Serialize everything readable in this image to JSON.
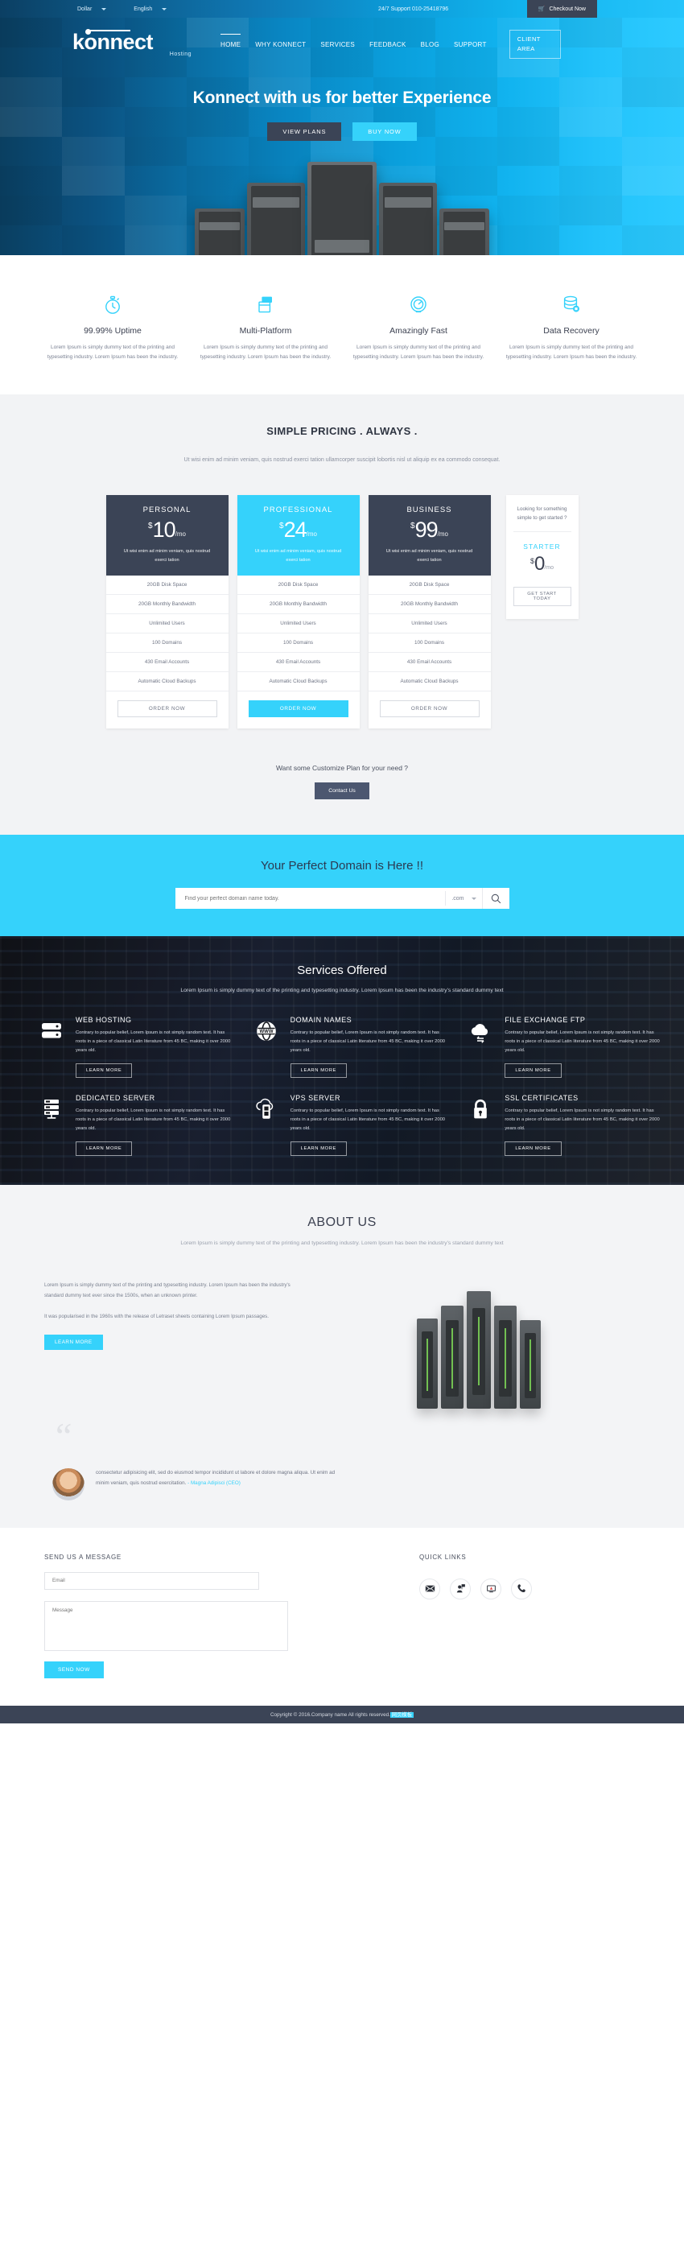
{
  "topbar": {
    "currency": "Dollar",
    "language": "English",
    "support": "24/7 Support 010-25418796",
    "checkout": "Checkout Now",
    "cart_icon": "cart-icon"
  },
  "brand": {
    "name": "konnect",
    "tagline": "Hosting"
  },
  "nav": {
    "items": [
      {
        "label": "HOME",
        "active": true
      },
      {
        "label": "WHY KONNECT",
        "active": false
      },
      {
        "label": "SERVICES",
        "active": false
      },
      {
        "label": "FEEDBACK",
        "active": false
      },
      {
        "label": "BLOG",
        "active": false
      },
      {
        "label": "SUPPORT",
        "active": false
      }
    ],
    "client_area_line1": "CLIENT",
    "client_area_line2": "AREA"
  },
  "hero": {
    "title": "Konnect with us for better Experience",
    "btn_primary": "VIEW PLANS",
    "btn_secondary": "BUY NOW"
  },
  "features": [
    {
      "icon": "stopwatch-icon",
      "title": "99.99% Uptime",
      "desc": "Lorem Ipsum is simply dummy text of the printing and typesetting industry. Lorem Ipsum has been the industry."
    },
    {
      "icon": "windows-icon",
      "title": "Multi-Platform",
      "desc": "Lorem Ipsum is simply dummy text of the printing and typesetting industry. Lorem Ipsum has been the industry."
    },
    {
      "icon": "speedometer-icon",
      "title": "Amazingly Fast",
      "desc": "Lorem Ipsum is simply dummy text of the printing and typesetting industry. Lorem Ipsum has been the industry."
    },
    {
      "icon": "database-icon",
      "title": "Data Recovery",
      "desc": "Lorem Ipsum is simply dummy text of the printing and typesetting industry. Lorem Ipsum has been the industry."
    }
  ],
  "pricing": {
    "title": "SIMPLE PRICING . ALWAYS .",
    "subtitle": "Ut wisi enim ad minim veniam, quis nostrud exerci tation ullamcorper suscipit lobortis nisl ut aliquip ex ea commodo consequat.",
    "plan_note": "Ut wisi enim ad minim veniam, quis nostrud exerci tation",
    "features": [
      "20GB Disk Space",
      "20GB Monthly Bandwidth",
      "Unlimited Users",
      "100 Domains",
      "430 Email Accounts",
      "Automatic Cloud Backups"
    ],
    "plans": [
      {
        "name": "PERSONAL",
        "currency": "$",
        "amount": "10",
        "period": "/mo",
        "cta": "ORDER NOW",
        "style": "dark"
      },
      {
        "name": "PROFESSIONAL",
        "currency": "$",
        "amount": "24",
        "period": "/mo",
        "cta": "ORDER NOW",
        "style": "cyan"
      },
      {
        "name": "BUSINESS",
        "currency": "$",
        "amount": "99",
        "period": "/mo",
        "cta": "ORDER NOW",
        "style": "dark"
      }
    ],
    "starter": {
      "question": "Looking for something simple to get started ?",
      "name": "STARTER",
      "currency": "$",
      "amount": "0",
      "period": "/mo",
      "cta": "GET START TODAY"
    },
    "custom_line": "Want some Customize Plan for your need ?",
    "custom_btn": "Contact Us"
  },
  "domain": {
    "title": "Your Perfect Domain is Here !!",
    "placeholder": "Find your perfect domain name today.",
    "tld": ".com",
    "search_icon": "search-icon"
  },
  "services": {
    "title": "Services Offered",
    "subtitle": "Lorem Ipsum is simply dummy text of the printing and typesetting industry. Lorem Ipsum has been the industry's standard dummy text",
    "learn_label": "LEARN MORE",
    "body": "Contrary to popular belief, Lorem Ipsum is not simply random text. It has roots in a piece of classical Latin literature from 45 BC, making it over 2000 years old.",
    "items": [
      {
        "icon": "server-stack-icon",
        "name": "WEB HOSTING"
      },
      {
        "icon": "globe-www-icon",
        "name": "DOMAIN NAMES"
      },
      {
        "icon": "cloud-exchange-icon",
        "name": "FILE EXCHANGE FTP"
      },
      {
        "icon": "rack-server-icon",
        "name": "DEDICATED SERVER"
      },
      {
        "icon": "cloud-server-icon",
        "name": "VPS SERVER"
      },
      {
        "icon": "padlock-icon",
        "name": "SSL CERTIFICATES"
      }
    ]
  },
  "about": {
    "title": "ABOUT US",
    "subtitle": "Lorem Ipsum is simply dummy text of the printing and typesetting industry. Lorem Ipsum has been the industry's standard dummy text",
    "p1": "Lorem Ipsum is simply dummy text of the printing and typesetting industry. Lorem Ipsum has been the industry's standard dummy text ever since the 1500s, when an unknown printer.",
    "p2": "It was popularised in the 1960s with the release of Letraset sheets containing Lorem Ipsum passages.",
    "btn": "LEARN MORE"
  },
  "testimonial": {
    "quote_icon": "quote-icon",
    "text": "consectetur adipisicing elit, sed do eiusmod tempor incididunt ut labore et dolore magna aliqua. Ut enim ad minim veniam, quis nostrud exercitation.",
    "author": "- Magna Adipisci (CEO)",
    "avatar": "avatar"
  },
  "contact": {
    "form_title": "SEND US A MESSAGE",
    "email_placeholder": "Email",
    "message_placeholder": "Message",
    "send_btn": "SEND NOW",
    "links_title": "QUICK LINKS",
    "links": [
      {
        "icon": "envelope-icon"
      },
      {
        "icon": "support-agent-icon"
      },
      {
        "icon": "monitor-icon"
      },
      {
        "icon": "phone-icon"
      }
    ]
  },
  "footer": {
    "copyright": "Copyright © 2016.Company name All rights reserved.",
    "badge": "网页模板"
  },
  "colors": {
    "cyan": "#35d2fb",
    "dark": "#3b4456",
    "hero_gradient_start": "#0a3f61",
    "hero_gradient_end": "#2dcbff"
  }
}
